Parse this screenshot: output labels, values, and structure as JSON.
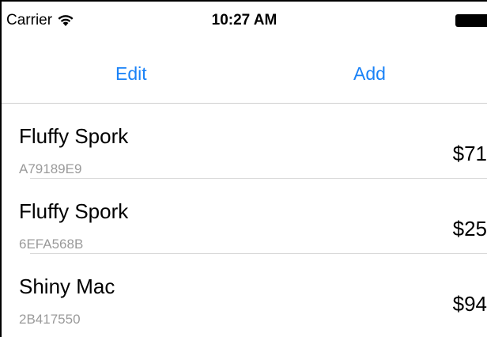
{
  "status_bar": {
    "carrier": "Carrier",
    "time": "10:27 AM",
    "wifi_icon": "wifi-icon",
    "battery_icon": "battery-icon"
  },
  "nav": {
    "edit_label": "Edit",
    "add_label": "Add",
    "accent_color": "#1a82f7"
  },
  "items": [
    {
      "title": "Fluffy Spork",
      "subtitle": "A79189E9",
      "price": "$71"
    },
    {
      "title": "Fluffy Spork",
      "subtitle": "6EFA568B",
      "price": "$25"
    },
    {
      "title": "Shiny Mac",
      "subtitle": "2B417550",
      "price": "$94"
    }
  ]
}
